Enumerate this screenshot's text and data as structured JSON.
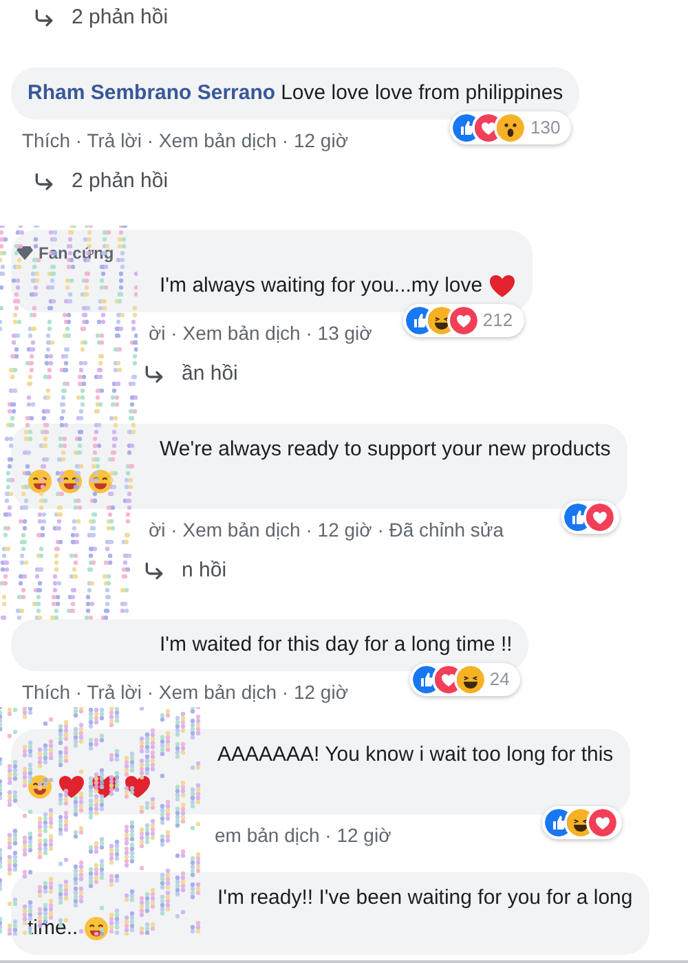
{
  "top_replies": {
    "label": "2 phản hồi"
  },
  "comments": [
    {
      "author": "Rham Sembrano Serrano",
      "lines": [
        "Love love love from philippines"
      ],
      "reactions": [
        {
          "kind": "like"
        },
        {
          "kind": "love"
        },
        {
          "kind": "wow"
        }
      ],
      "reaction_count": "130",
      "actions": "Thích · Trả lời · Xem bản dịch · 12 giờ",
      "replies": "2 phản hồi"
    },
    {
      "badge": "Fan cứng",
      "lines": [
        "I'm always waiting for you...my love"
      ],
      "emojis": [
        {
          "kind": "heart"
        }
      ],
      "emojis_inline": true,
      "reactions": [
        {
          "kind": "like"
        },
        {
          "kind": "haha"
        },
        {
          "kind": "love"
        }
      ],
      "reaction_count": "212",
      "actions": "ời · Xem bản dịch · 13 giờ",
      "replies": "ần hồi"
    },
    {
      "lines": [
        "We're always ready to support your new products"
      ],
      "emojis": [
        {
          "kind": "grin"
        },
        {
          "kind": "grin"
        },
        {
          "kind": "grin"
        }
      ],
      "emojis_inline": false,
      "reactions": [
        {
          "kind": "like"
        },
        {
          "kind": "love"
        }
      ],
      "actions": "ời · Xem bản dịch · 12 giờ · Đã chỉnh sửa",
      "replies": "n hồi"
    },
    {
      "lines": [
        "I'm waited for this day for a long time !!"
      ],
      "reactions": [
        {
          "kind": "like"
        },
        {
          "kind": "love"
        },
        {
          "kind": "haha"
        }
      ],
      "reaction_count": "24",
      "actions": "Thích · Trả lời · Xem bản dịch · 12 giờ"
    },
    {
      "lines": [
        "AAAAAAA! You know i wait too long for this"
      ],
      "emojis": [
        {
          "kind": "grin"
        },
        {
          "kind": "heart"
        },
        {
          "kind": "heart"
        },
        {
          "kind": "heart"
        }
      ],
      "emojis_inline": false,
      "reactions": [
        {
          "kind": "like"
        },
        {
          "kind": "haha"
        },
        {
          "kind": "love"
        }
      ],
      "actions": "em bản dịch · 12 giờ"
    },
    {
      "lines": [
        "I'm ready!! I've been waiting for you for a long",
        "time.."
      ],
      "emojis": [
        {
          "kind": "grin"
        }
      ],
      "emojis_inline": true
    }
  ]
}
